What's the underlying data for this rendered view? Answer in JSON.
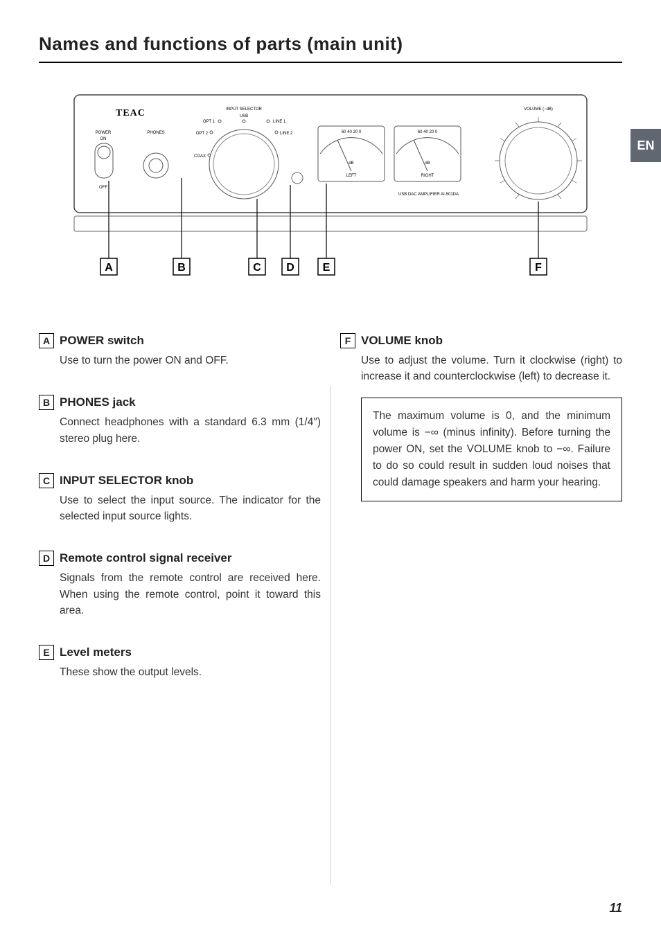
{
  "title": "Names and functions of parts (main unit)",
  "lang_tab": "EN",
  "page_number": "11",
  "diagram": {
    "brand": "TEAC",
    "labels": {
      "input_selector": "INPUT SELECTOR",
      "usb": "USB",
      "opt1": "OPT 1",
      "opt2": "OPT 2",
      "coax": "COAX",
      "line1": "LINE 1",
      "line2": "LINE 2",
      "power": "POWER",
      "on": "ON",
      "off": "OFF",
      "phones": "PHONES",
      "volume": "VOLUME (−dB)",
      "db": "dB",
      "left_meter": "LEFT",
      "right_meter": "RIGHT",
      "scale": "60  40  20  0",
      "model": "USB DAC AMPLIFIER AI-501DA"
    },
    "callouts": [
      "A",
      "B",
      "C",
      "D",
      "E",
      "F"
    ]
  },
  "entries": {
    "A": {
      "title": "POWER switch",
      "body": "Use to turn the power ON and OFF."
    },
    "B": {
      "title": "PHONES jack",
      "body": "Connect headphones with a standard 6.3 mm (1/4″) stereo plug here."
    },
    "C": {
      "title": "INPUT SELECTOR knob",
      "body": "Use to select the input source. The indicator for the selected input source lights."
    },
    "D": {
      "title": "Remote control signal receiver",
      "body": "Signals from the remote control are received here. When using the remote control, point it toward this area."
    },
    "E": {
      "title": "Level meters",
      "body": "These show the output levels."
    },
    "F": {
      "title": "VOLUME knob",
      "body": "Use to adjust the volume. Turn it clockwise (right) to increase it and counterclockwise (left) to decrease it.",
      "note": "The maximum volume is 0, and the minimum volume is −∞ (minus infinity). Before turning the power ON, set the VOLUME knob to −∞. Failure to do so could result in sudden loud noises that could damage speakers and harm your hearing."
    }
  }
}
